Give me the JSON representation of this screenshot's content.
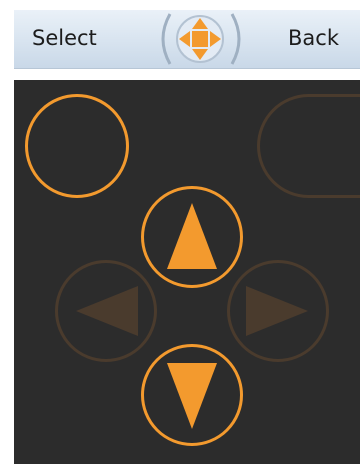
{
  "softkeys": {
    "left_label": "Select",
    "right_label": "Back"
  },
  "nav_hint_icon": "dpad-arrows-icon",
  "colors": {
    "accent": "#f39a2e",
    "disabled": "#4a3b2d",
    "pad_background": "#2c2c2c"
  },
  "pad": {
    "buttons": [
      {
        "name": "top-left-button",
        "state": "enabled",
        "icon": "none"
      },
      {
        "name": "top-right-button",
        "state": "disabled",
        "icon": "none"
      },
      {
        "name": "up-button",
        "state": "enabled",
        "icon": "up-arrow-icon"
      },
      {
        "name": "left-button",
        "state": "disabled",
        "icon": "left-arrow-icon"
      },
      {
        "name": "right-button",
        "state": "disabled",
        "icon": "right-arrow-icon"
      },
      {
        "name": "down-button",
        "state": "enabled",
        "icon": "down-arrow-icon"
      }
    ]
  }
}
